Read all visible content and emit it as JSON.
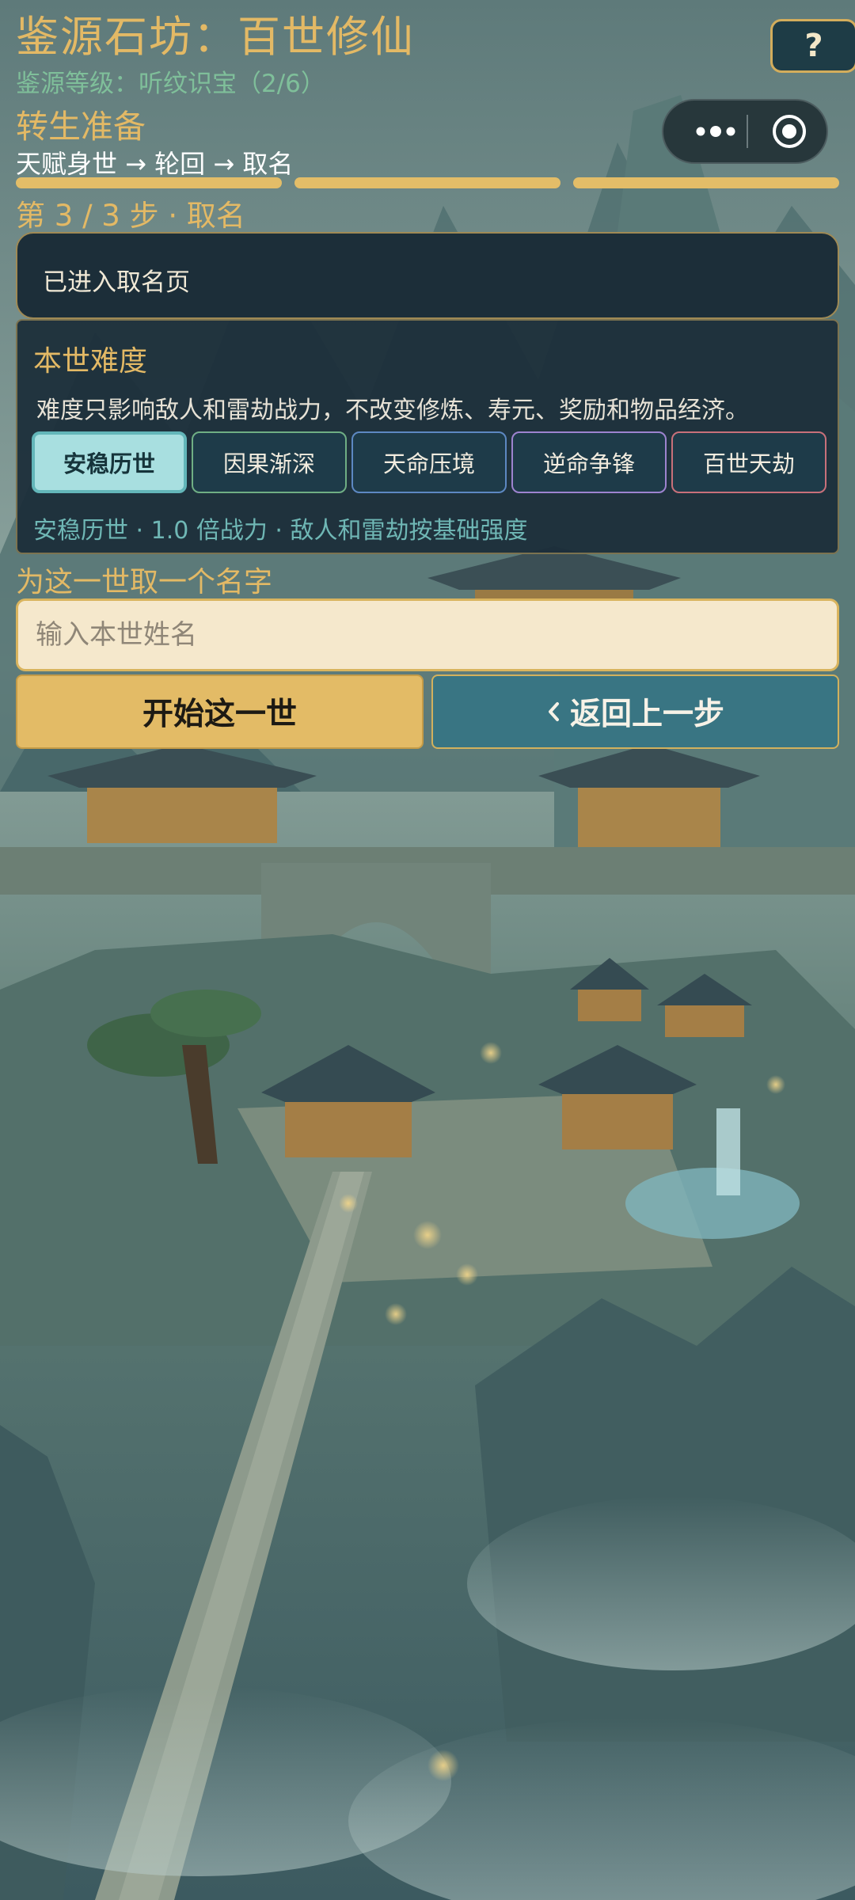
{
  "header": {
    "game_title": "鉴源石坊：百世修仙",
    "rank_line": "鉴源等级：听纹识宝（2/6）",
    "help_label": "?"
  },
  "reincarnation": {
    "section_title": "转生准备",
    "breadcrumb": "天赋身世 → 轮回 → 取名",
    "progress_steps_filled": 3,
    "progress_steps_total": 3,
    "step_label": "第 3 / 3 步 · 取名"
  },
  "notice": {
    "text": "已进入取名页"
  },
  "difficulty": {
    "title": "本世难度",
    "description": "难度只影响敌人和雷劫战力，不改变修炼、寿元、奖励和物品经济。",
    "options": [
      {
        "label": "安稳历世",
        "border_color": "#63b6b9",
        "selected": true
      },
      {
        "label": "因果渐深",
        "border_color": "#6fae84",
        "selected": false
      },
      {
        "label": "天命压境",
        "border_color": "#5d88c2",
        "selected": false
      },
      {
        "label": "逆命争锋",
        "border_color": "#9d83cf",
        "selected": false
      },
      {
        "label": "百世天劫",
        "border_color": "#c8707a",
        "selected": false
      }
    ],
    "summary": "安稳历世 · 1.0 倍战力 · 敌人和雷劫按基础强度"
  },
  "naming": {
    "label": "为这一世取一个名字",
    "value": "",
    "placeholder": "输入本世姓名"
  },
  "actions": {
    "start_label": "开始这一世",
    "back_label": "返回上一步",
    "back_icon": "chevron-left-icon"
  },
  "colors": {
    "gold": "#e3b965",
    "panel": "#1c2e39",
    "start_button": "#e3bb66",
    "back_button": "#397583"
  }
}
